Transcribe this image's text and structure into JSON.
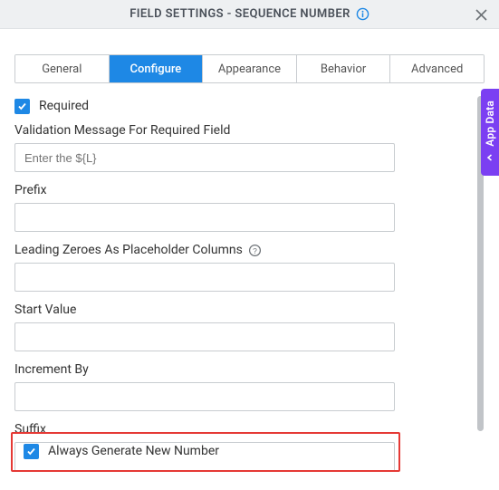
{
  "header": {
    "title": "FIELD SETTINGS - SEQUENCE NUMBER"
  },
  "tabs": [
    "General",
    "Configure",
    "Appearance",
    "Behavior",
    "Advanced"
  ],
  "form": {
    "required": {
      "label": "Required",
      "checked": true
    },
    "validationMessage": {
      "label": "Validation Message For Required Field",
      "placeholder": "Enter the ${L}"
    },
    "prefix": {
      "label": "Prefix"
    },
    "leadingZeroes": {
      "label": "Leading Zeroes As Placeholder Columns"
    },
    "startValue": {
      "label": "Start Value"
    },
    "incrementBy": {
      "label": "Increment By"
    },
    "suffix": {
      "label": "Suffix"
    },
    "alwaysGenerate": {
      "label": "Always Generate New Number",
      "checked": true
    }
  },
  "sideTab": {
    "label": "App Data"
  }
}
